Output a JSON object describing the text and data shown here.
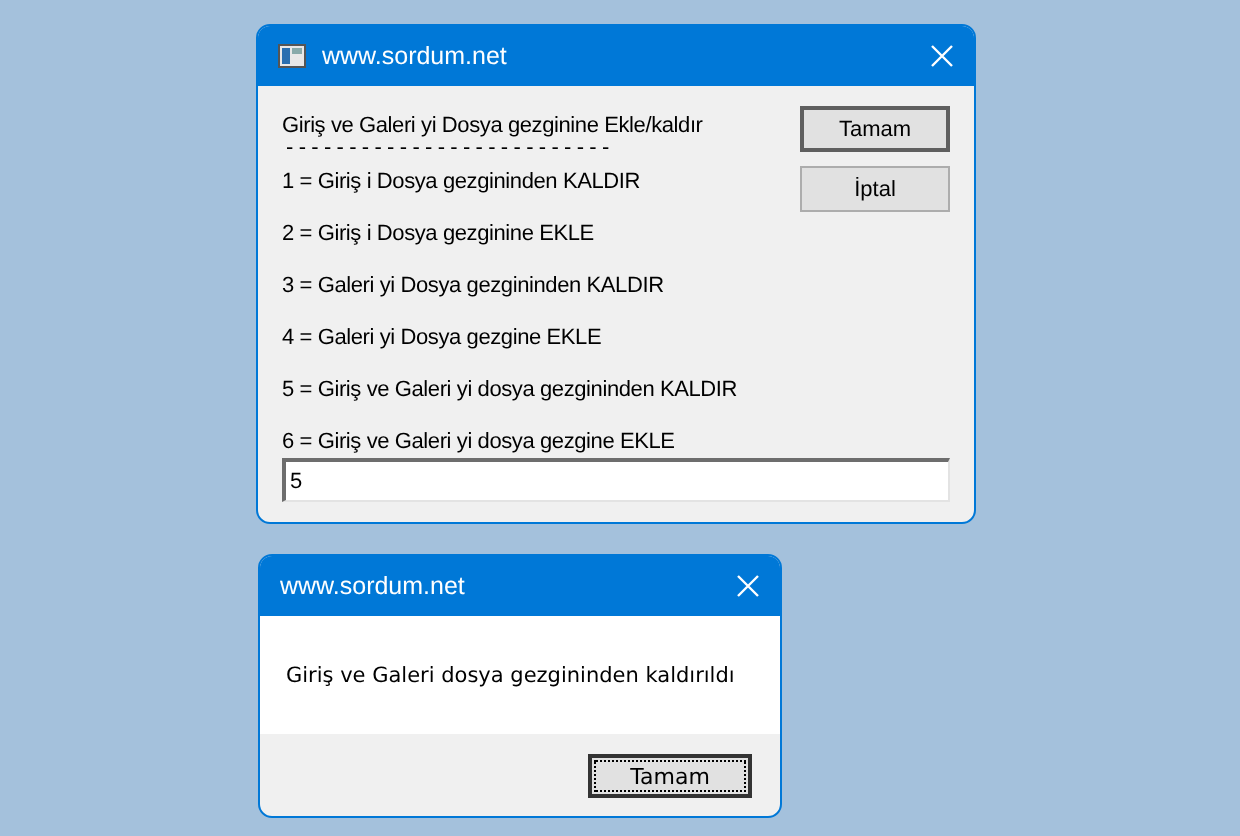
{
  "input_dialog": {
    "title": "www.sordum.net",
    "prompt_lines": [
      "Giriş ve Galeri yi Dosya gezginine Ekle/kaldır",
      "- - - - - - - - - - - - - - - - - - - - - - - - - -",
      "1 = Giriş i Dosya gezgininden KALDIR",
      "2 = Giriş i Dosya gezginine EKLE",
      "3 = Galeri yi Dosya gezgininden KALDIR",
      "4 = Galeri yi Dosya gezgine EKLE",
      "5 = Giriş ve Galeri yi dosya gezgininden KALDIR",
      "6 = Giriş ve Galeri yi dosya gezgine EKLE"
    ],
    "buttons": [
      {
        "label": "Tamam",
        "default": true
      },
      {
        "label": "İptal",
        "default": false
      }
    ],
    "input": {
      "value": "5"
    }
  },
  "message_box": {
    "title": "www.sordum.net",
    "message": "Giriş ve Galeri dosya gezgininden kaldırıldı",
    "buttons": [
      {
        "label": "Tamam",
        "focused": true
      }
    ]
  }
}
